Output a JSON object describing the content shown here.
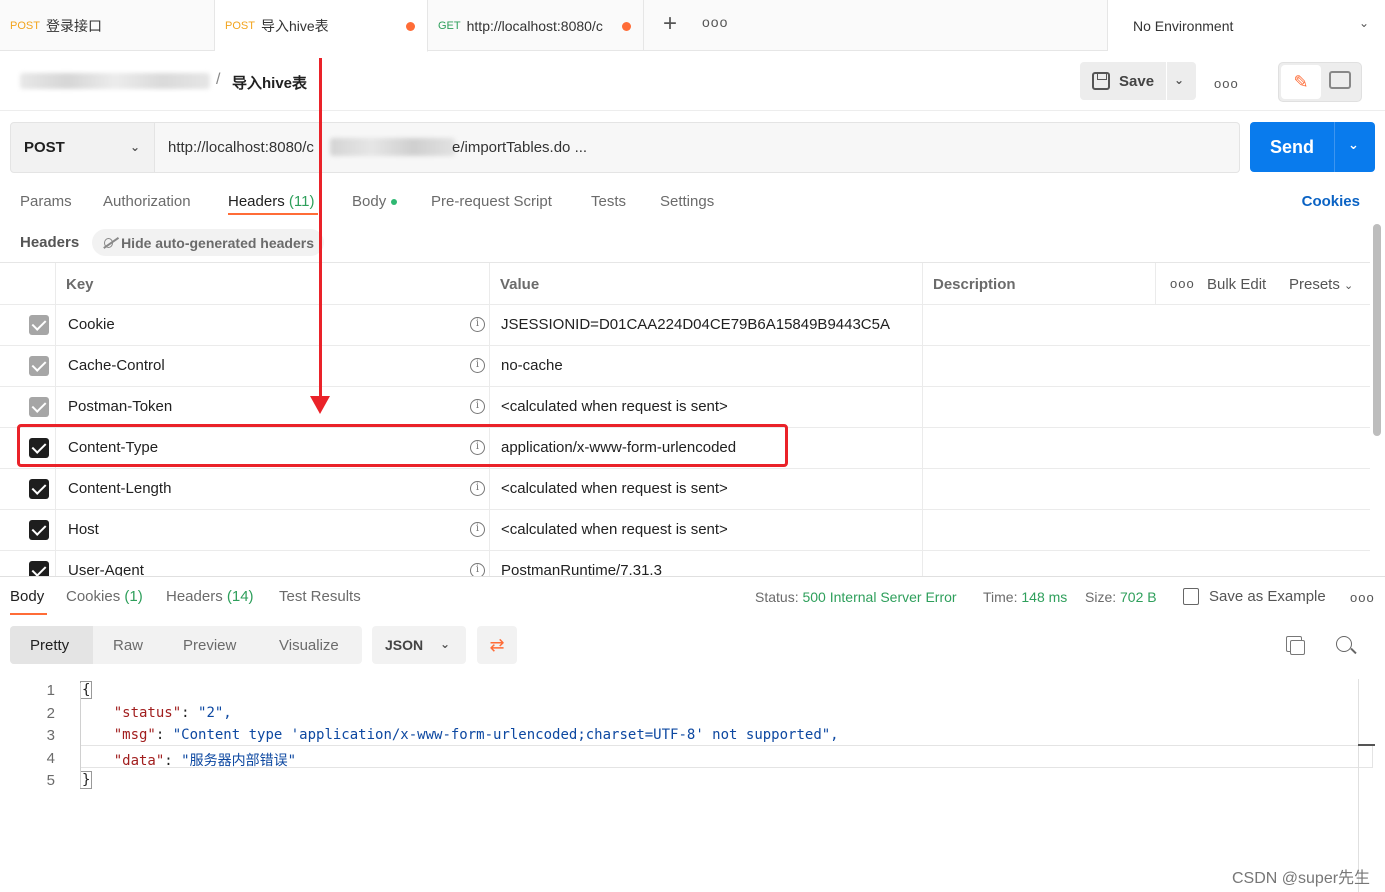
{
  "tabs": [
    {
      "method": "POST",
      "name": "登录接口",
      "unsaved": false
    },
    {
      "method": "POST",
      "name": "导入hive表",
      "unsaved": true
    },
    {
      "method": "GET",
      "name": "http://localhost:8080/c",
      "unsaved": true
    }
  ],
  "tabbar": {
    "add": "+",
    "more": "ooo"
  },
  "environment": {
    "label": "No Environment"
  },
  "breadcrumb": {
    "separator": "/",
    "title": "导入hive表"
  },
  "toolbar": {
    "save_label": "Save",
    "more": "ooo"
  },
  "request": {
    "method": "POST",
    "url_start": "http://localhost:8080/c",
    "url_end": "e/importTables.do ...",
    "send_label": "Send"
  },
  "request_tabs": [
    {
      "label": "Params",
      "count": ""
    },
    {
      "label": "Authorization",
      "count": ""
    },
    {
      "label": "Headers",
      "count": "(11)"
    },
    {
      "label": "Body",
      "count": ""
    },
    {
      "label": "Pre-request Script",
      "count": ""
    },
    {
      "label": "Tests",
      "count": ""
    },
    {
      "label": "Settings",
      "count": ""
    }
  ],
  "cookies_link": "Cookies",
  "headers_section": {
    "title": "Headers",
    "hide_auto": "Hide auto-generated headers"
  },
  "headers_table": {
    "columns": {
      "key": "Key",
      "value": "Value",
      "description": "Description"
    },
    "tools": {
      "more": "ooo",
      "bulk_edit": "Bulk Edit",
      "presets": "Presets"
    },
    "rows": [
      {
        "key": "Cookie",
        "value": "JSESSIONID=D01CAA224D04CE79B6A15849B9443C5A",
        "checked": "auto"
      },
      {
        "key": "Cache-Control",
        "value": "no-cache",
        "checked": "auto"
      },
      {
        "key": "Postman-Token",
        "value": "<calculated when request is sent>",
        "checked": "auto"
      },
      {
        "key": "Content-Type",
        "value": "application/x-www-form-urlencoded",
        "checked": "on"
      },
      {
        "key": "Content-Length",
        "value": "<calculated when request is sent>",
        "checked": "on"
      },
      {
        "key": "Host",
        "value": "<calculated when request is sent>",
        "checked": "on"
      },
      {
        "key": "User-Agent",
        "value": "PostmanRuntime/7.31.3",
        "checked": "on"
      }
    ]
  },
  "response_tabs": [
    {
      "label": "Body",
      "count": ""
    },
    {
      "label": "Cookies",
      "count": "(1)"
    },
    {
      "label": "Headers",
      "count": "(14)"
    },
    {
      "label": "Test Results",
      "count": ""
    }
  ],
  "response_status": {
    "status_label": "Status:",
    "status_value": "500 Internal Server Error",
    "time_label": "Time:",
    "time_value": "148 ms",
    "size_label": "Size:",
    "size_value": "702 B",
    "save_example": "Save as Example",
    "more": "ooo"
  },
  "view_tabs": [
    "Pretty",
    "Raw",
    "Preview",
    "Visualize"
  ],
  "format": "JSON",
  "response_body": [
    {
      "num": "1",
      "text": "{"
    },
    {
      "num": "2",
      "key": "\"status\"",
      "value": "\"2\","
    },
    {
      "num": "3",
      "key": "\"msg\"",
      "value": "\"Content type 'application/x-www-form-urlencoded;charset=UTF-8' not supported\","
    },
    {
      "num": "4",
      "key": "\"data\"",
      "value": "\"服务器内部错误\""
    },
    {
      "num": "5",
      "text": "}"
    }
  ],
  "watermark": "CSDN @super先生",
  "colors": {
    "accent": "#ff6c37",
    "send": "#097bed",
    "status_ok": "#2e9f5b",
    "annotation": "#ea2229"
  }
}
